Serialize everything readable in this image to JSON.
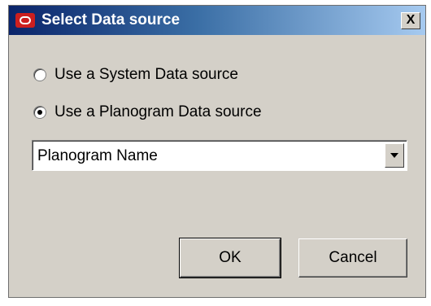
{
  "window": {
    "title": "Select Data source",
    "close_label": "X"
  },
  "options": {
    "system_label": "Use a System Data source",
    "system_selected": false,
    "planogram_label": "Use a Planogram Data source",
    "planogram_selected": true
  },
  "dropdown": {
    "value": "Planogram Name"
  },
  "buttons": {
    "ok_label": "OK",
    "cancel_label": "Cancel"
  },
  "icons": {
    "app": "oracle-logo-icon",
    "close": "close-icon",
    "dropdown": "chevron-down-icon"
  },
  "colors": {
    "title_bar_start": "#0a246a",
    "title_bar_end": "#a6caf0",
    "dialog_background": "#d4d0c8",
    "logo": "#cc1f1f"
  }
}
